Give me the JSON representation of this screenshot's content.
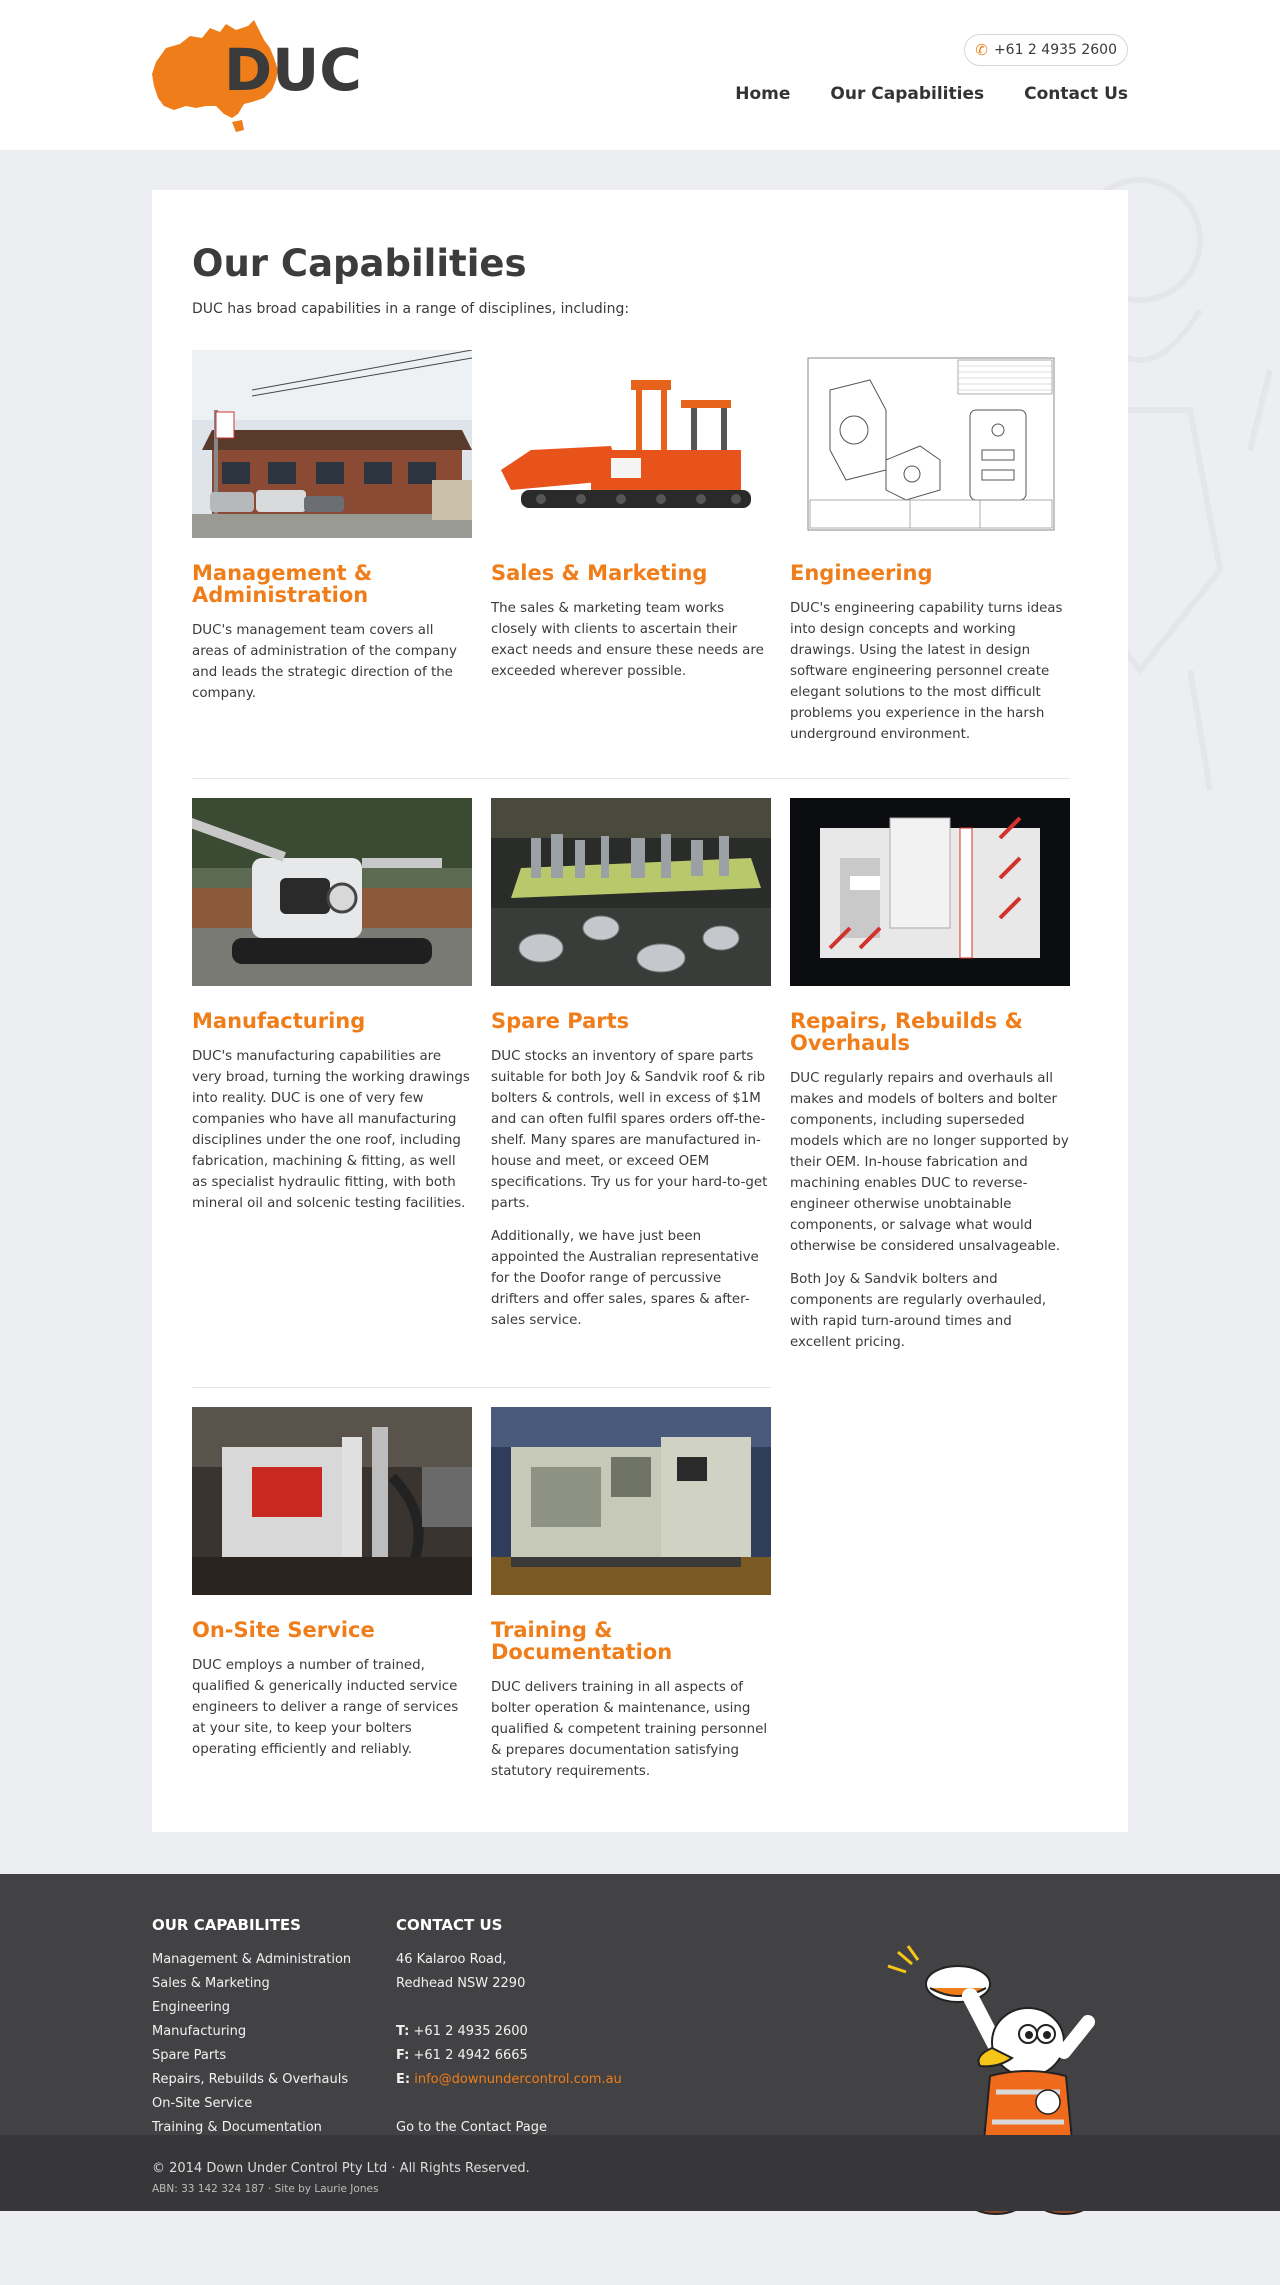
{
  "header": {
    "logo_text": "DUC",
    "phone": "+61 2 4935 2600",
    "nav": [
      "Home",
      "Our Capabilities",
      "Contact Us"
    ]
  },
  "page": {
    "title": "Our Capabilities",
    "intro": "DUC has broad capabilities in a range of disciplines, including:"
  },
  "capabilities": [
    {
      "title": "Management & Administration",
      "paragraphs": [
        "DUC's management team covers all areas of administration of the company and leads the strategic direction of the company."
      ]
    },
    {
      "title": "Sales & Marketing",
      "paragraphs": [
        "The sales & marketing team works closely with clients to ascertain their exact needs and ensure these needs are exceeded wherever possible."
      ]
    },
    {
      "title": "Engineering",
      "paragraphs": [
        "DUC's engineering capability turns ideas into design concepts and working drawings. Using the latest in design software engineering personnel create elegant solutions to the most difficult problems you experience in the harsh underground environment."
      ]
    },
    {
      "title": "Manufacturing",
      "paragraphs": [
        "DUC's manufacturing capabilities are very broad, turning the working drawings into reality. DUC is one of very few companies who have all manufacturing disciplines under the one roof, including fabrication, machining & fitting, as well as specialist hydraulic fitting, with both mineral oil and solcenic testing facilities."
      ]
    },
    {
      "title": "Spare Parts",
      "paragraphs": [
        "DUC stocks an inventory of spare parts suitable for both Joy & Sandvik roof & rib bolters & controls, well in excess of $1M and can often fulfil spares orders off-the-shelf. Many spares are manufactured in-house and meet, or exceed OEM specifications. Try us for your hard-to-get parts.",
        "Additionally, we have just been appointed the Australian representative for the Doofor range of percussive drifters and offer sales, spares & after-sales service."
      ]
    },
    {
      "title": "Repairs, Rebuilds & Overhauls",
      "paragraphs": [
        "DUC regularly repairs and overhauls all makes and models of bolters and bolter components, including superseded models which are no longer supported by their OEM. In-house fabrication and machining enables DUC to reverse-engineer otherwise unobtainable components, or salvage what would otherwise be considered unsalvageable.",
        "Both Joy & Sandvik bolters and components are regularly overhauled, with rapid turn-around times and excellent pricing."
      ]
    },
    {
      "title": "On-Site Service",
      "paragraphs": [
        "DUC employs a number of trained, qualified & generically inducted service engineers to deliver a range of services at your site, to keep your bolters operating efficiently and reliably."
      ]
    },
    {
      "title": "Training & Documentation",
      "paragraphs": [
        "DUC delivers training in all aspects of bolter operation & maintenance, using qualified & competent training personnel & prepares documentation satisfying statutory requirements."
      ]
    }
  ],
  "footer": {
    "col1_heading": "OUR CAPABILITES",
    "col1_links": [
      "Management & Administration",
      "Sales & Marketing",
      "Engineering",
      "Manufacturing",
      "Spare Parts",
      "Repairs, Rebuilds & Overhauls",
      "On-Site Service",
      "Training & Documentation"
    ],
    "col2_heading": "CONTACT US",
    "address_line1": "46 Kalaroo Road,",
    "address_line2": "Redhead NSW 2290",
    "tel_label": "T:",
    "tel": "+61 2 4935 2600",
    "fax_label": "F:",
    "fax": "+61 2 4942 6665",
    "email_label": "E:",
    "email": "info@downundercontrol.com.au",
    "contact_link": "Go to the Contact Page",
    "copyright": "© 2014 Down Under Control Pty Ltd · All Rights Reserved.",
    "abn": "ABN: 33 142 324 187 · Site by Laurie Jones"
  },
  "colors": {
    "accent": "#ef7d1a",
    "footer_bg": "#424244",
    "footer_bottom": "#373739",
    "page_bg": "#eceef1"
  },
  "icons": [
    "phone-icon"
  ]
}
